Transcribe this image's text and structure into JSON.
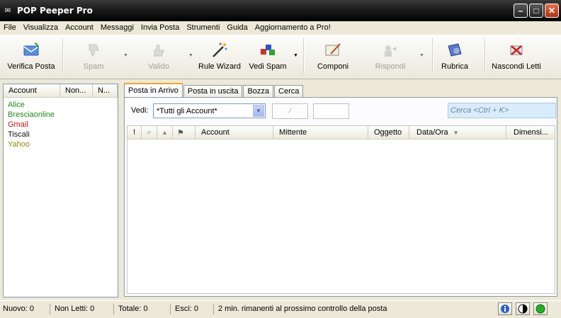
{
  "window": {
    "title": "POP Peeper Pro"
  },
  "menu": [
    "File",
    "Visualizza",
    "Account",
    "Messaggi",
    "Invia Posta",
    "Strumenti",
    "Guida",
    "Aggiornamento a Pro!"
  ],
  "toolbar": {
    "verifica": "Verifica Posta",
    "spam": "Spam",
    "valido": "Valido",
    "rule_wizard": "Rule Wizard",
    "vedi_spam": "Vedi Spam",
    "componi": "Componi",
    "rispondi": "Rispondi",
    "rubrica": "Rubrica",
    "nascondi": "Nascondi Letti"
  },
  "accounts_pane": {
    "headers": [
      "Account",
      "Non...",
      "N..."
    ],
    "items": [
      {
        "name": "Alice",
        "color": "#1a8a1a"
      },
      {
        "name": "Bresciaonline",
        "color": "#1a8a1a"
      },
      {
        "name": "Gmail",
        "color": "#d01010"
      },
      {
        "name": "Tiscali",
        "color": "#111111"
      },
      {
        "name": "Yahoo",
        "color": "#8a8a10"
      }
    ]
  },
  "tabs": [
    "Posta in Arrivo",
    "Posta in uscita",
    "Bozza",
    "Cerca"
  ],
  "filter": {
    "vedi_label": "Vedi:",
    "vedi_value": "*Tutti gli Account*",
    "search_placeholder": "Cerca <Ctrl + K>"
  },
  "columns": [
    "!",
    "",
    "",
    "",
    "Account",
    "Mittente",
    "Oggetto",
    "Data/Ora",
    "Dimensi..."
  ],
  "status": {
    "nuovo": "Nuovo: 0",
    "non_letti": "Non Letti: 0",
    "totale": "Totale: 0",
    "esci": "Esci: 0",
    "message": "2 min. rimanenti al prossimo controllo della posta"
  }
}
